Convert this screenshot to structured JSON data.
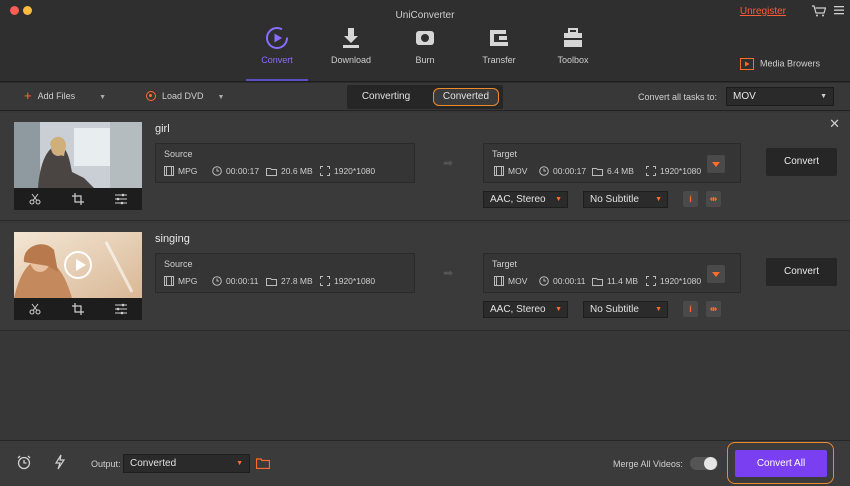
{
  "window": {
    "title": "UniConverter",
    "unregister_label": "Unregister"
  },
  "nav": {
    "items": [
      {
        "label": "Convert",
        "icon": "convert-icon",
        "active": true
      },
      {
        "label": "Download",
        "icon": "download-icon"
      },
      {
        "label": "Burn",
        "icon": "burn-icon"
      },
      {
        "label": "Transfer",
        "icon": "transfer-icon"
      },
      {
        "label": "Toolbox",
        "icon": "toolbox-icon"
      }
    ],
    "media_browser_label": "Media Browers"
  },
  "toolbar": {
    "add_files_label": "Add Files",
    "load_dvd_label": "Load DVD",
    "tabs": {
      "converting": "Converting",
      "converted": "Converted"
    },
    "convert_all_label": "Convert all tasks to:",
    "convert_all_format": "MOV"
  },
  "files": [
    {
      "name": "girl",
      "source": {
        "title": "Source",
        "format": "MPG",
        "duration": "00:00:17",
        "size": "20.6 MB",
        "resolution": "1920*1080"
      },
      "target": {
        "title": "Target",
        "format": "MOV",
        "duration": "00:00:17",
        "size": "6.4 MB",
        "resolution": "1920*1080"
      },
      "audio": "AAC, Stereo",
      "subtitle": "No Subtitle",
      "convert_label": "Convert"
    },
    {
      "name": "singing",
      "source": {
        "title": "Source",
        "format": "MPG",
        "duration": "00:00:11",
        "size": "27.8 MB",
        "resolution": "1920*1080"
      },
      "target": {
        "title": "Target",
        "format": "MOV",
        "duration": "00:00:11",
        "size": "11.4 MB",
        "resolution": "1920*1080"
      },
      "audio": "AAC, Stereo",
      "subtitle": "No Subtitle",
      "convert_label": "Convert"
    }
  ],
  "footer": {
    "output_label": "Output:",
    "output_value": "Converted",
    "merge_label": "Merge All Videos:",
    "merge_enabled": false,
    "convert_all_button": "Convert All"
  },
  "colors": {
    "accent_purple": "#7a3ff0",
    "accent_orange": "#ff6a2e",
    "highlight_ring": "#ef8a2c",
    "nav_active": "#8a6dff"
  }
}
